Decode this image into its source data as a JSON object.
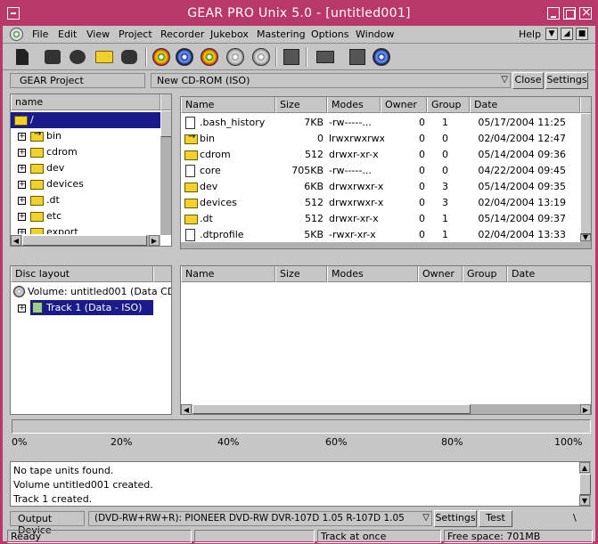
{
  "window": {
    "title": "GEAR PRO Unix 5.0 - [untitled001]"
  },
  "menu": {
    "items": [
      "File",
      "Edit",
      "View",
      "Project",
      "Recorder",
      "Jukebox",
      "Mastering",
      "Options",
      "Window"
    ],
    "help": "Help"
  },
  "project_bar": {
    "label": "GEAR Project",
    "combo_value": "New CD-ROM (ISO)",
    "close_label": "Close",
    "settings_label": "Settings"
  },
  "tree": {
    "header": "name",
    "items": [
      {
        "name": "/",
        "selected": true
      },
      {
        "name": "bin",
        "link": true
      },
      {
        "name": "cdrom"
      },
      {
        "name": "dev"
      },
      {
        "name": "devices"
      },
      {
        "name": ".dt"
      },
      {
        "name": "etc"
      },
      {
        "name": "export"
      }
    ]
  },
  "files": {
    "headers": [
      "Name",
      "Size",
      "Modes",
      "Owner",
      "Group",
      "Date"
    ],
    "rows": [
      {
        "name": ".bash_history",
        "size": "7KB",
        "modes": "-rw-----...",
        "owner": "0",
        "group": "1",
        "date": "05/17/2004 11:25",
        "kind": "file"
      },
      {
        "name": "bin",
        "size": "0",
        "modes": "lrwxrwxrwx",
        "owner": "0",
        "group": "0",
        "date": "02/04/2004 12:47",
        "kind": "link"
      },
      {
        "name": "cdrom",
        "size": "512",
        "modes": "drwxr-xr-x",
        "owner": "0",
        "group": "0",
        "date": "05/14/2004 09:36",
        "kind": "folder"
      },
      {
        "name": "core",
        "size": "705KB",
        "modes": "-rw-----...",
        "owner": "0",
        "group": "0",
        "date": "04/22/2004 09:45",
        "kind": "file"
      },
      {
        "name": "dev",
        "size": "6KB",
        "modes": "drwxrwxr-x",
        "owner": "0",
        "group": "3",
        "date": "05/14/2004 09:35",
        "kind": "folder"
      },
      {
        "name": "devices",
        "size": "512",
        "modes": "drwxrwxr-x",
        "owner": "0",
        "group": "3",
        "date": "02/04/2004 13:19",
        "kind": "folder"
      },
      {
        "name": ".dt",
        "size": "512",
        "modes": "drwxr-xr-x",
        "owner": "0",
        "group": "1",
        "date": "05/14/2004 09:37",
        "kind": "folder"
      },
      {
        "name": ".dtprofile",
        "size": "5KB",
        "modes": "-rwxr-xr-x",
        "owner": "0",
        "group": "1",
        "date": "02/04/2004 13:33",
        "kind": "file"
      }
    ]
  },
  "disc_layout": {
    "header": "Disc layout",
    "volume": "Volume: untitled001 (Data CD",
    "track": "Track 1 (Data - ISO)"
  },
  "disc_files": {
    "headers": [
      "Name",
      "Size",
      "Modes",
      "Owner",
      "Group",
      "Date"
    ]
  },
  "progress": {
    "labels": [
      "0%",
      "20%",
      "40%",
      "60%",
      "80%",
      "100%"
    ],
    "value_percent": 0
  },
  "log": {
    "lines": [
      "No tape units found.",
      "Volume untitled001 created.",
      "Track 1 created."
    ]
  },
  "device_bar": {
    "label": "Output Device",
    "device": "(DVD-RW+RW+R): PIONEER DVD-RW  DVR-107D 1.05  R-107D 1.05",
    "settings_label": "Settings",
    "test_label": "Test"
  },
  "status": {
    "ready": "Ready",
    "mode": "Track at once",
    "free_space": "Free space: 701MB"
  }
}
